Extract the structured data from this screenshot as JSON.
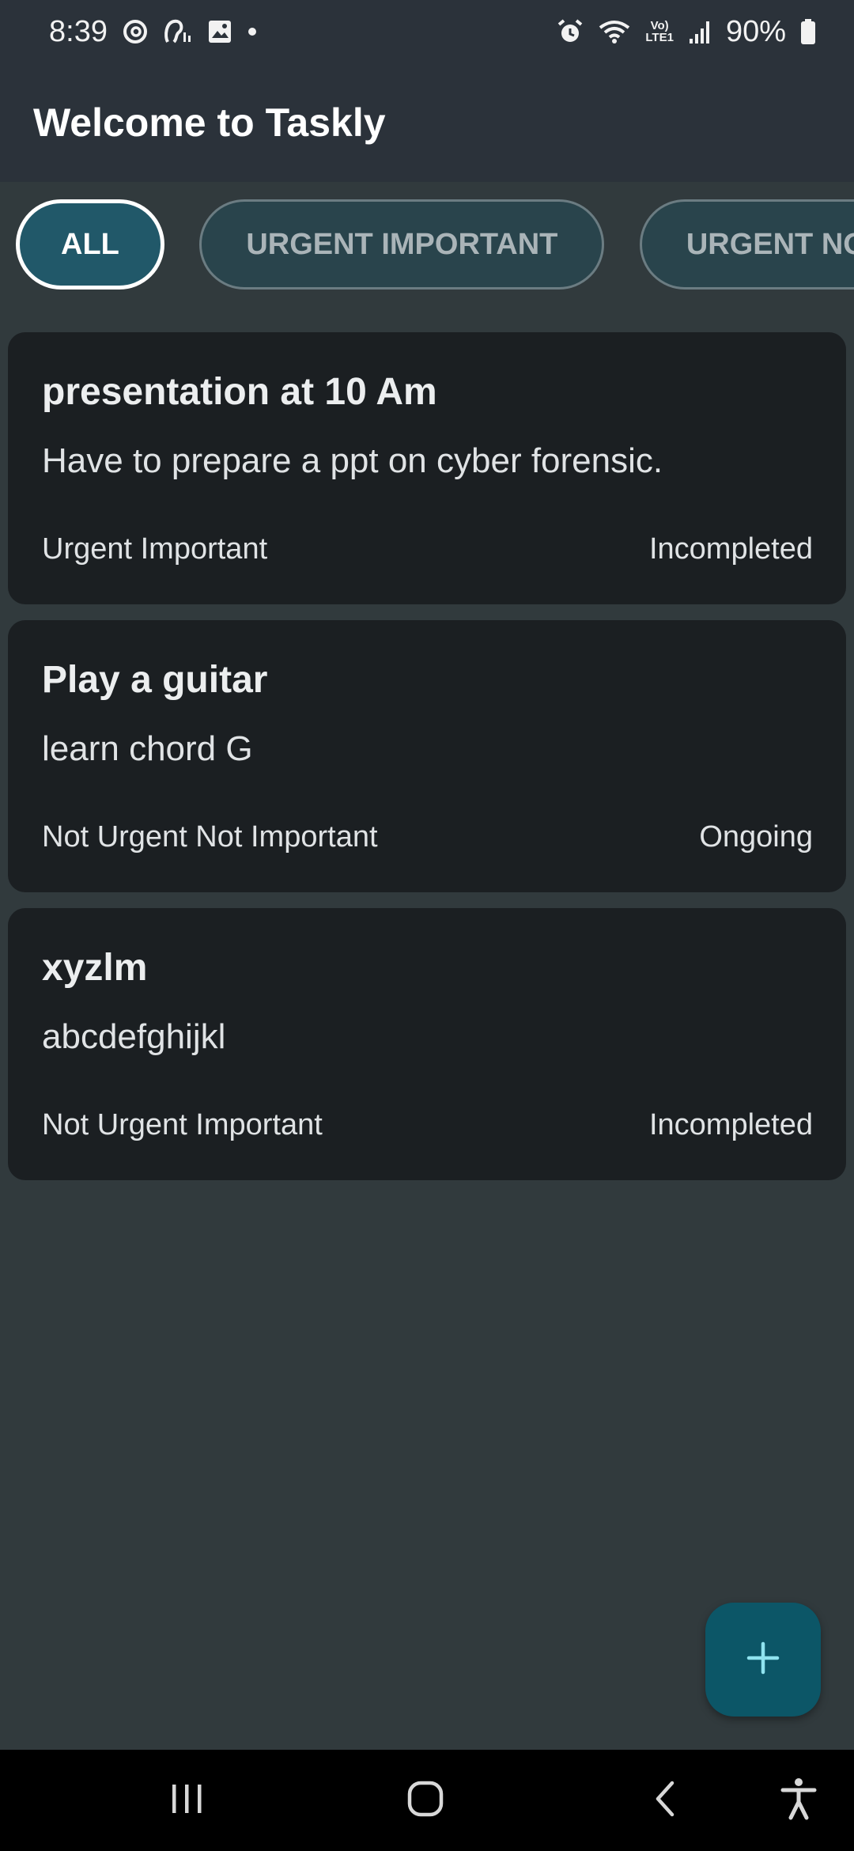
{
  "status_bar": {
    "time": "8:39",
    "battery": "90%",
    "left_icons": [
      "threads-icon",
      "hearing-icon",
      "image-icon",
      "dot-icon"
    ],
    "right_icons": [
      "alarm-icon",
      "wifi-icon",
      "volte-icon",
      "signal-icon",
      "battery-icon"
    ],
    "volte_line1": "Vo)",
    "volte_line2": "LTE1"
  },
  "app_bar": {
    "title": "Welcome to Taskly"
  },
  "filters": [
    {
      "label": "ALL",
      "selected": true
    },
    {
      "label": "URGENT IMPORTANT",
      "selected": false
    },
    {
      "label": "URGENT NO",
      "selected": false
    }
  ],
  "tasks": [
    {
      "title": "presentation at 10 Am",
      "description": "Have to prepare a ppt on cyber forensic.",
      "category": "Urgent Important",
      "status": "Incompleted"
    },
    {
      "title": "Play a guitar",
      "description": "learn chord G",
      "category": "Not Urgent Not Important",
      "status": "Ongoing"
    },
    {
      "title": "xyzlm",
      "description": "abcdefghijkl",
      "category": "Not Urgent Important",
      "status": "Incompleted"
    }
  ],
  "fab": {
    "icon": "plus-icon"
  },
  "nav_bar": {
    "icons": [
      "recent-apps-icon",
      "home-icon",
      "back-icon",
      "accessibility-icon"
    ]
  },
  "colors": {
    "background": "#313a3d",
    "app_bar": "#2b323a",
    "card": "#1b1f22",
    "chip_selected": "#215869",
    "chip": "#29444c",
    "fab": "#0c5667",
    "fab_icon": "#8fe3ef"
  }
}
